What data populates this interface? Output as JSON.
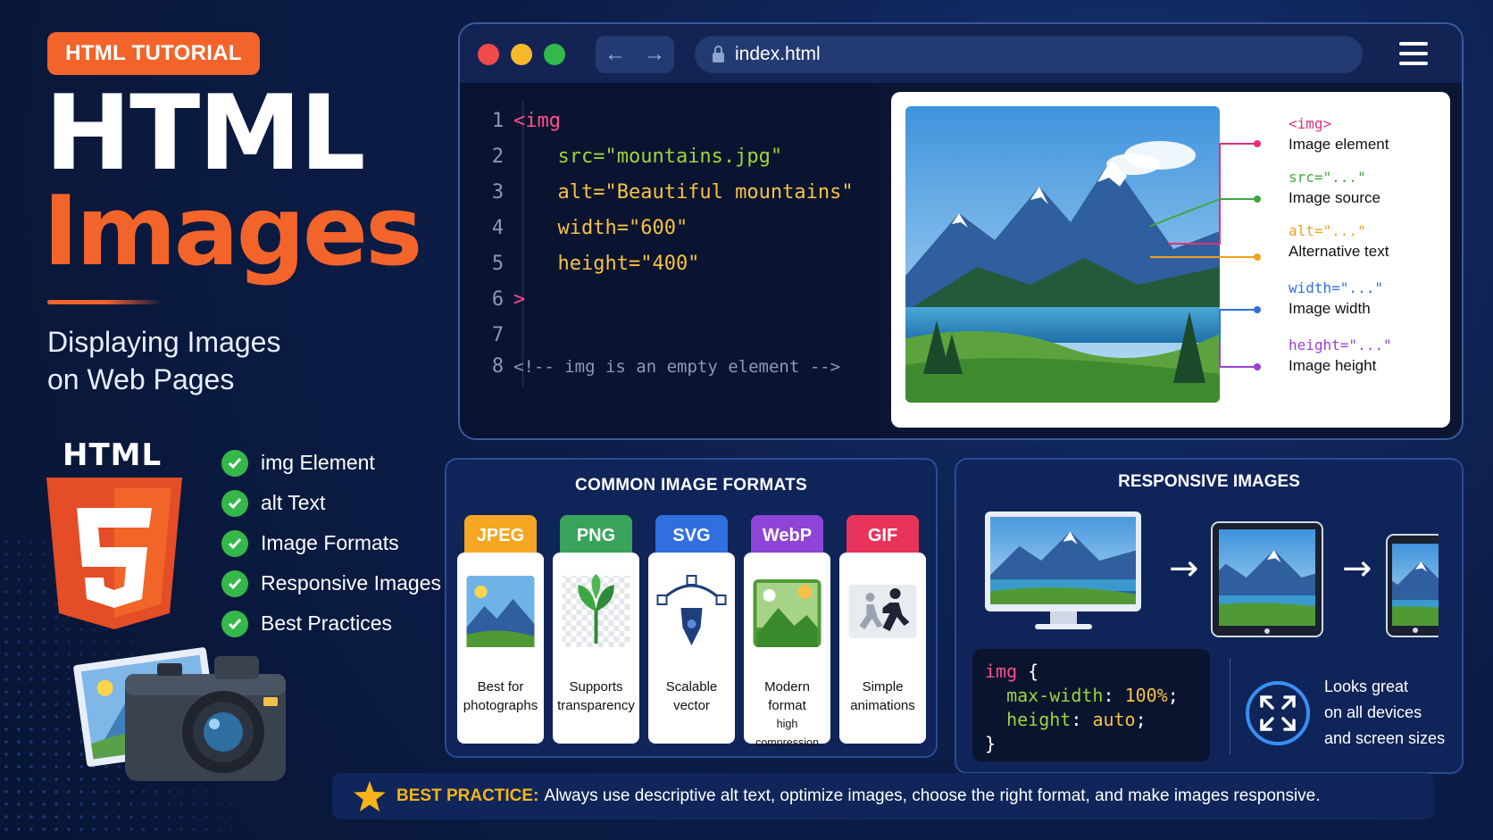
{
  "header": {
    "tag": "HTML TUTORIAL",
    "title_line1": "HTML",
    "title_line2": "Images",
    "subtitle_line1": "Displaying Images",
    "subtitle_line2": "on Web Pages",
    "html5_word": "HTML"
  },
  "checklist": [
    "img Element",
    "alt Text",
    "Image Formats",
    "Responsive Images",
    "Best Practices"
  ],
  "browser": {
    "url": "index.html",
    "code_lines": [
      {
        "n": "1",
        "text": "<img",
        "color": "#ff4f8b"
      },
      {
        "n": "2",
        "text": "  src=\"mountains.jpg\"",
        "color": "#9ed43a"
      },
      {
        "n": "3",
        "text": "  alt=\"Beautiful mountains\"",
        "color": "#f7c243"
      },
      {
        "n": "4",
        "text": "  width=\"600\"",
        "color": "#f7c243"
      },
      {
        "n": "5",
        "text": "  height=\"400\"",
        "color": "#f7c243"
      },
      {
        "n": "6",
        "text": ">",
        "color": "#ff4f8b"
      },
      {
        "n": "7",
        "text": "",
        "color": "#ffffff"
      },
      {
        "n": "8",
        "text": "<!-- img is an empty element -->",
        "color": "#8b98b8"
      }
    ],
    "annotations": [
      {
        "code": "<img>",
        "label": "Image element",
        "color": "#e2307a"
      },
      {
        "code": "src=\"...\"",
        "label": "Image source",
        "color": "#3da843"
      },
      {
        "code": "alt=\"...\"",
        "label": "Alternative text",
        "color": "#f0a020"
      },
      {
        "code": "width=\"...\"",
        "label": "Image width",
        "color": "#2f6fe0"
      },
      {
        "code": "height=\"...\"",
        "label": "Image height",
        "color": "#9b3fd6"
      }
    ]
  },
  "formats": {
    "title": "COMMON IMAGE FORMATS",
    "items": [
      {
        "name": "JPEG",
        "desc1": "Best for",
        "desc2": "photographs",
        "color": "#f5a623",
        "icon": "photo-icon"
      },
      {
        "name": "PNG",
        "desc1": "Supports",
        "desc2": "transparency",
        "color": "#3aa35b",
        "icon": "leaf-icon"
      },
      {
        "name": "SVG",
        "desc1": "Scalable",
        "desc2": "vector",
        "color": "#2f6fe0",
        "icon": "pen-tool-icon"
      },
      {
        "name": "WebP",
        "desc1": "Modern format",
        "desc2": "high compression",
        "color": "#8e44d6",
        "icon": "image-icon"
      },
      {
        "name": "GIF",
        "desc1": "Simple",
        "desc2": "animations",
        "color": "#e8335b",
        "icon": "running-icon"
      }
    ]
  },
  "responsive": {
    "title": "RESPONSIVE IMAGES",
    "css_selector": "img",
    "css_open": "{",
    "css_prop1": "max-width",
    "css_val1": "100%",
    "css_prop2": "height",
    "css_val2": "auto",
    "css_close": "}",
    "looks_line1": "Looks great",
    "looks_line2": "on all devices",
    "looks_line3": "and screen sizes"
  },
  "best_practice": {
    "label": "BEST PRACTICE:",
    "text": "Always use descriptive alt text, optimize images, choose the right format, and make images responsive."
  }
}
